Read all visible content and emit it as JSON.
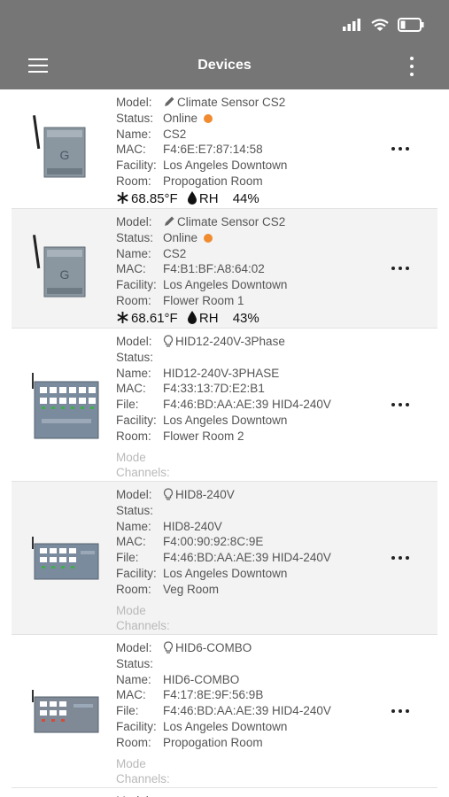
{
  "app": {
    "title": "Devices"
  },
  "labels": {
    "model": "Model:",
    "status": "Status:",
    "name": "Name:",
    "mac": "MAC:",
    "file": "File:",
    "facility": "Facility:",
    "room": "Room:",
    "mode": "Mode",
    "channels": "Channels:",
    "rh": "RH"
  },
  "devices": [
    {
      "model": "Climate Sensor CS2",
      "status": "Online",
      "name": "CS2",
      "mac": "F4:6E:E7:87:14:58",
      "facility": "Los Angeles Downtown",
      "room": "Propogation Room",
      "temp": "68.85°F",
      "rh": "44%"
    },
    {
      "model": "Climate Sensor CS2",
      "status": "Online",
      "name": "CS2",
      "mac": "F4:B1:BF:A8:64:02",
      "facility": "Los Angeles Downtown",
      "room": "Flower Room 1",
      "temp": "68.61°F",
      "rh": "43%"
    },
    {
      "model": "HID12-240V-3Phase",
      "status": "",
      "name": "HID12-240V-3PHASE",
      "mac": "F4:33:13:7D:E2:B1",
      "file": "F4:46:BD:AA:AE:39 HID4-240V",
      "facility": "Los Angeles Downtown",
      "room": "Flower Room 2"
    },
    {
      "model": "HID8-240V",
      "status": "",
      "name": "HID8-240V",
      "mac": "F4:00:90:92:8C:9E",
      "file": "F4:46:BD:AA:AE:39 HID4-240V",
      "facility": "Los Angeles Downtown",
      "room": "Veg Room"
    },
    {
      "model": "HID6-COMBO",
      "status": "",
      "name": "HID6-COMBO",
      "mac": "F4:17:8E:9F:56:9B",
      "file": "F4:46:BD:AA:AE:39 HID4-240V",
      "facility": "Los Angeles Downtown",
      "room": "Propogation Room"
    }
  ]
}
